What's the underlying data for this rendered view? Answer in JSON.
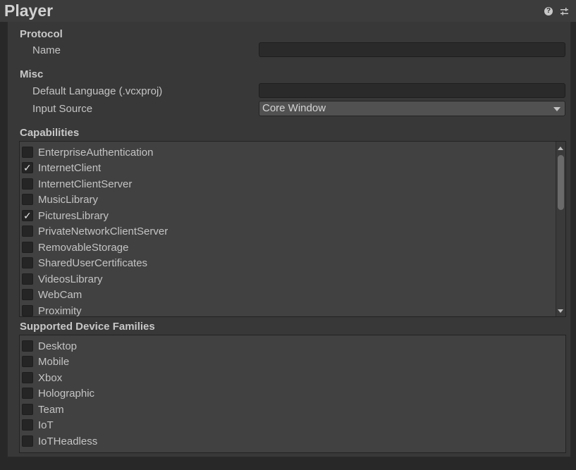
{
  "header": {
    "title": "Player"
  },
  "protocol": {
    "section_label": "Protocol",
    "name_label": "Name",
    "name_value": ""
  },
  "misc": {
    "section_label": "Misc",
    "default_language_label": "Default Language (.vcxproj)",
    "default_language_value": "",
    "input_source_label": "Input Source",
    "input_source_value": "Core Window"
  },
  "capabilities": {
    "section_label": "Capabilities",
    "items": [
      {
        "label": "EnterpriseAuthentication",
        "checked": false
      },
      {
        "label": "InternetClient",
        "checked": true
      },
      {
        "label": "InternetClientServer",
        "checked": false
      },
      {
        "label": "MusicLibrary",
        "checked": false
      },
      {
        "label": "PicturesLibrary",
        "checked": true
      },
      {
        "label": "PrivateNetworkClientServer",
        "checked": false
      },
      {
        "label": "RemovableStorage",
        "checked": false
      },
      {
        "label": "SharedUserCertificates",
        "checked": false
      },
      {
        "label": "VideosLibrary",
        "checked": false
      },
      {
        "label": "WebCam",
        "checked": false
      },
      {
        "label": "Proximity",
        "checked": false
      }
    ]
  },
  "device_families": {
    "section_label": "Supported Device Families",
    "items": [
      {
        "label": "Desktop",
        "checked": false
      },
      {
        "label": "Mobile",
        "checked": false
      },
      {
        "label": "Xbox",
        "checked": false
      },
      {
        "label": "Holographic",
        "checked": false
      },
      {
        "label": "Team",
        "checked": false
      },
      {
        "label": "IoT",
        "checked": false
      },
      {
        "label": "IoTHeadless",
        "checked": false
      }
    ]
  },
  "icons": {
    "help": "help-icon",
    "settings": "settings-icon",
    "check": "checkmark-icon"
  }
}
